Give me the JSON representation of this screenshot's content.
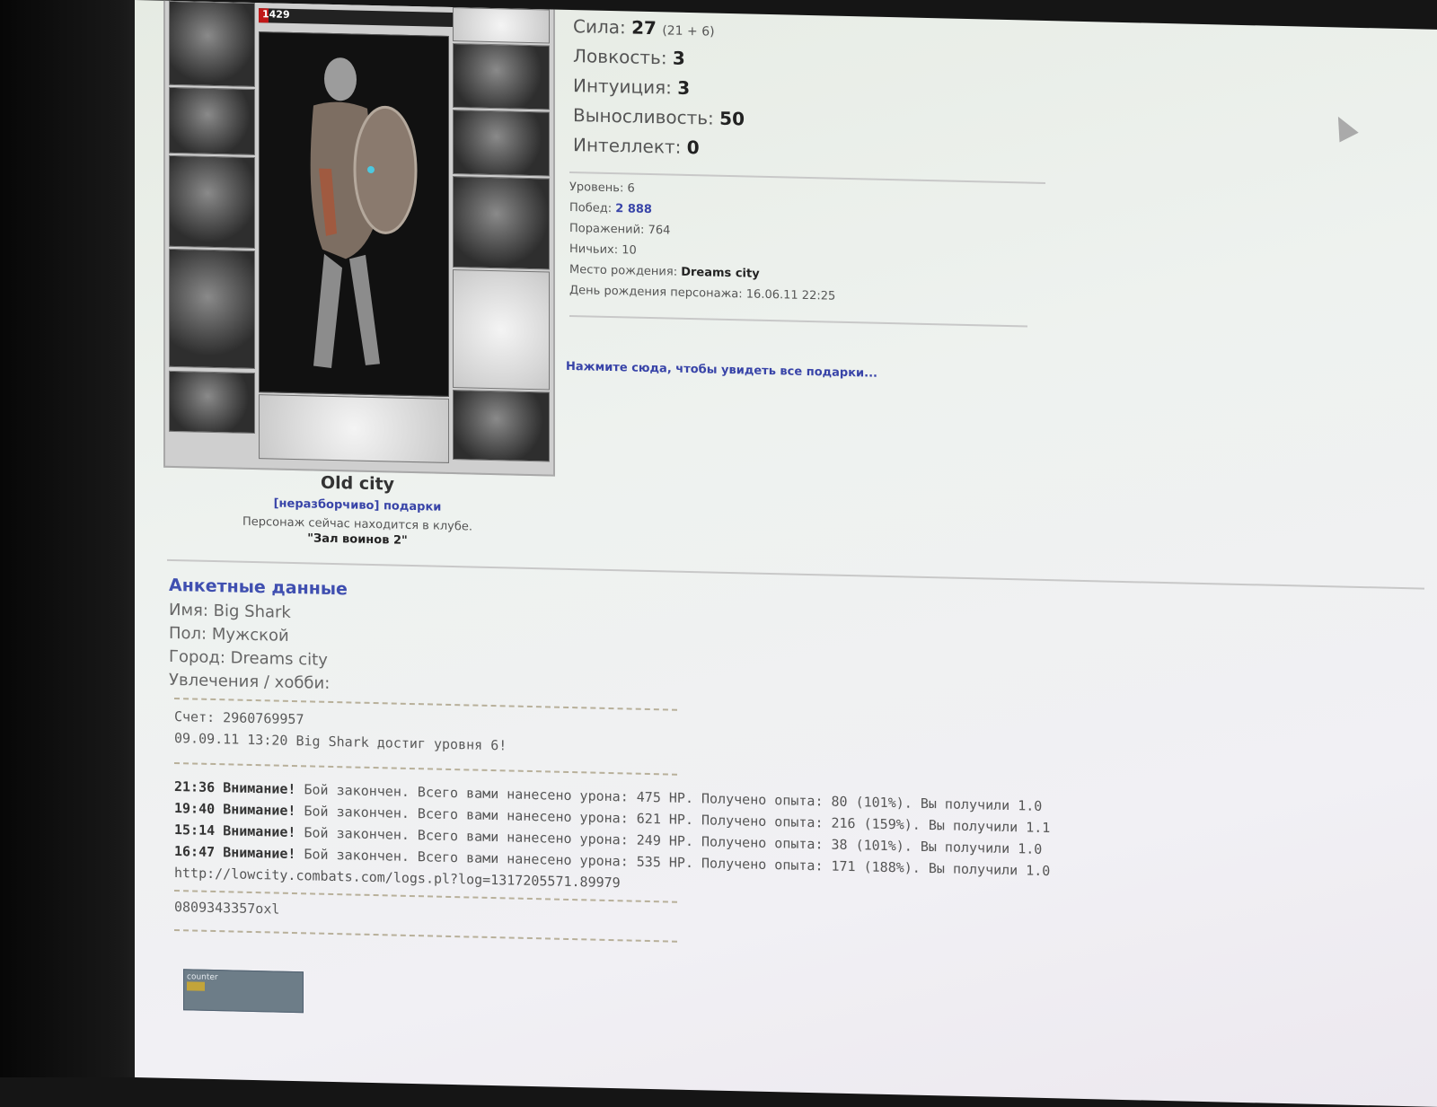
{
  "doll": {
    "hp_text": "1429",
    "hp_fraction": 0.05
  },
  "city_name": "Old city",
  "gifts_link": "[неразборчиво] подарки",
  "location_text": "Персонаж сейчас находится в клубе.",
  "location_room": "\"Зал воинов 2\"",
  "stats": [
    {
      "label": "Сила:",
      "value": "27",
      "mod": "(21 + 6)"
    },
    {
      "label": "Ловкость:",
      "value": "3",
      "mod": ""
    },
    {
      "label": "Интуиция:",
      "value": "3",
      "mod": ""
    },
    {
      "label": "Выносливость:",
      "value": "50",
      "mod": ""
    },
    {
      "label": "Интеллект:",
      "value": "0",
      "mod": ""
    }
  ],
  "info": {
    "level_label": "Уровень:",
    "level": "6",
    "wins_label": "Побед:",
    "wins": "2 888",
    "losses_label": "Поражений:",
    "losses": "764",
    "draws_label": "Ничьих:",
    "draws": "10",
    "birthplace_label": "Место рождения:",
    "birthplace": "Dreams city",
    "birthday_label": "День рождения персонажа:",
    "birthday": "16.06.11 22:25"
  },
  "all_gifts_link": "Нажмите сюда, чтобы увидеть все подарки...",
  "bio": {
    "header": "Анкетные данные",
    "name": "Имя: Big Shark",
    "gender": "Пол: Мужской",
    "city": "Город: Dreams city",
    "hobby": "Увлечения / хобби:"
  },
  "account": "Счет: 2960769957",
  "event": "09.09.11 13:20 Big Shark достиг уровня 6!",
  "log": [
    {
      "time": "21:36",
      "text": "Бой закончен. Всего вами нанесено урона: 475 HP. Получено опыта: 80 (101%). Вы получили 1.0"
    },
    {
      "time": "19:40",
      "text": "Бой закончен. Всего вами нанесено урона: 621 HP. Получено опыта: 216 (159%). Вы получили 1.1"
    },
    {
      "time": "15:14",
      "text": "Бой закончен. Всего вами нанесено урона: 249 HP. Получено опыта: 38 (101%). Вы получили 1.0"
    },
    {
      "time": "16:47",
      "text": "Бой закончен. Всего вами нанесено урона: 535 HP. Получено опыта: 171 (188%). Вы получили 1.0"
    }
  ],
  "log_label": "Внимание!",
  "log_url": "http://lowcity.combats.com/logs.pl?log=1317205571.89979",
  "code": "0809343357oxl",
  "badge_text": "counter"
}
